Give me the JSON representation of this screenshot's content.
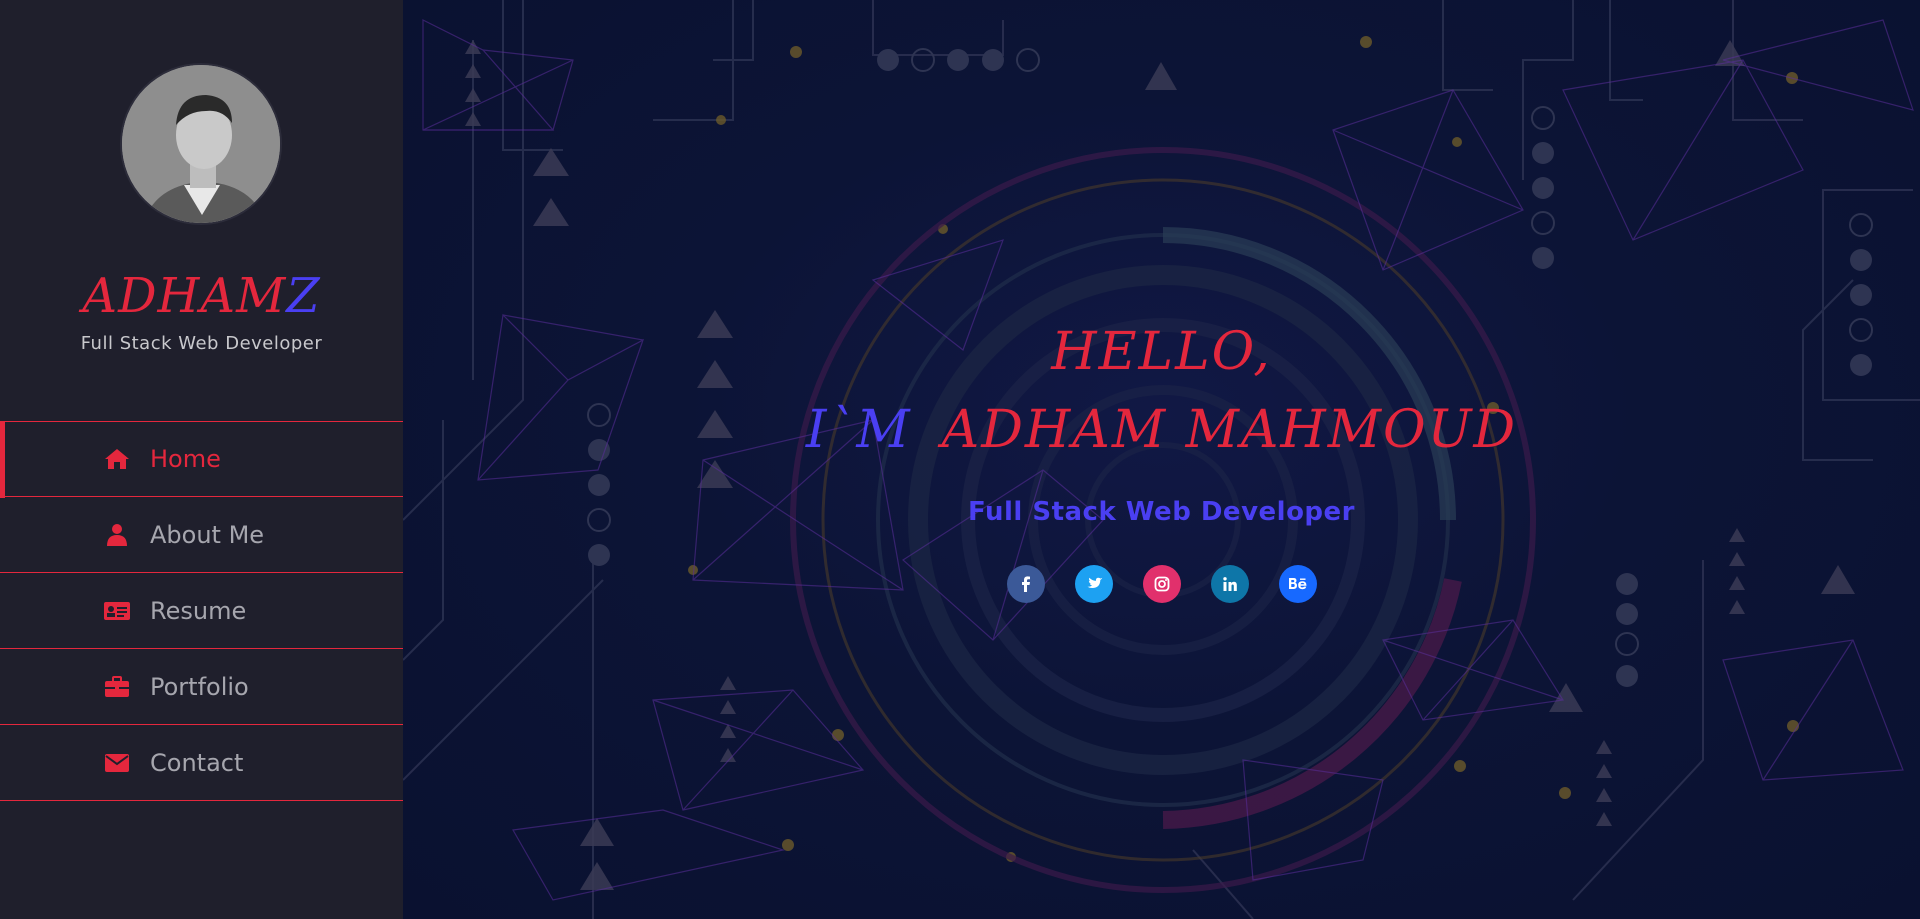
{
  "sidebar": {
    "brand_red": "ADHAM",
    "brand_blue": "Z",
    "subtitle": "Full Stack Web Developer",
    "nav": [
      {
        "label": "Home",
        "icon": "home-icon",
        "active": true
      },
      {
        "label": "About Me",
        "icon": "user-icon",
        "active": false
      },
      {
        "label": "Resume",
        "icon": "id-card-icon",
        "active": false
      },
      {
        "label": "Portfolio",
        "icon": "briefcase-icon",
        "active": false
      },
      {
        "label": "Contact",
        "icon": "envelope-icon",
        "active": false
      }
    ]
  },
  "hero": {
    "hello": "HELLO,",
    "im": "I`M",
    "name": "ADHAM MAHMOUD",
    "role": "Full Stack Web Developer"
  },
  "socials": [
    {
      "name": "facebook",
      "glyph": "f",
      "color": "#3b5998"
    },
    {
      "name": "twitter",
      "glyph": "t",
      "color": "#1da1f2"
    },
    {
      "name": "instagram",
      "glyph": "ig",
      "color": "#e1306c"
    },
    {
      "name": "linkedin",
      "glyph": "in",
      "color": "#0e76a8"
    },
    {
      "name": "behance",
      "glyph": "Bē",
      "color": "#1769ff"
    }
  ],
  "colors": {
    "accent_red": "#e4273d",
    "accent_blue": "#4a3ff2",
    "sidebar_bg": "#1f1f2c",
    "main_bg": "#0c1436"
  }
}
